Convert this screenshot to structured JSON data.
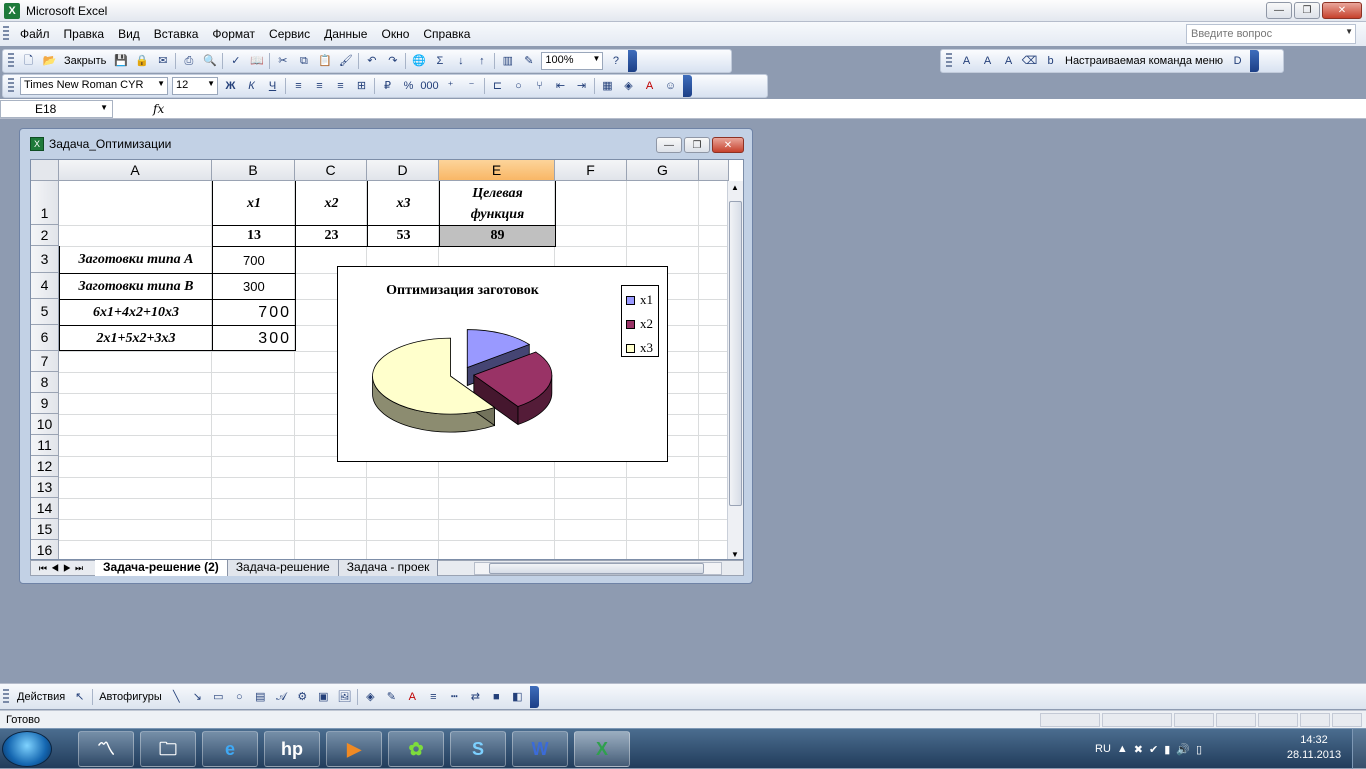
{
  "app": {
    "title": "Microsoft Excel"
  },
  "menu": [
    "Файл",
    "Правка",
    "Вид",
    "Вставка",
    "Формат",
    "Сервис",
    "Данные",
    "Окно",
    "Справка"
  ],
  "help_placeholder": "Введите вопрос",
  "toolbar": {
    "close_label": "Закрыть",
    "sigma": "Σ",
    "zoom": "100%"
  },
  "toolbar_custom": {
    "label": "Настраиваемая команда меню"
  },
  "format_toolbar": {
    "font": "Times New Roman CYR",
    "size": "12",
    "bold": "Ж",
    "italic": "К",
    "underline": "Ч",
    "percent": "%",
    "thousands": "000"
  },
  "formula_bar": {
    "name_box": "E18",
    "fx": "fx",
    "content": ""
  },
  "workbook": {
    "title": "Задача_Оптимизации"
  },
  "columns": [
    "A",
    "B",
    "C",
    "D",
    "E",
    "F",
    "G"
  ],
  "rows": [
    "1",
    "2",
    "3",
    "4",
    "5",
    "6",
    "7",
    "8",
    "9",
    "10",
    "11",
    "12",
    "13",
    "14",
    "15",
    "16"
  ],
  "cells": {
    "B1": "x1",
    "C1": "x2",
    "D1": "x3",
    "E1_line1": "Целевая",
    "E1_line2": "функция",
    "B2": "13",
    "C2": "23",
    "D2": "53",
    "E2": "89",
    "A3": "Заготовки типа А",
    "B3": "700",
    "A4": "Заготовки типа В",
    "B4": "300",
    "A5": "6x1+4x2+10x3",
    "B5": "700",
    "A6": "2x1+5x2+3x3",
    "B6": "300"
  },
  "chart_data": {
    "type": "pie",
    "title": "Оптимизация заготовок",
    "categories": [
      "x1",
      "x2",
      "x3"
    ],
    "values": [
      13,
      23,
      53
    ],
    "colors": [
      "#9999ff",
      "#993366",
      "#ffffcc"
    ],
    "style": "3d-exploded",
    "legend": "right"
  },
  "sheet_tabs": [
    "Задача-решение (2)",
    "Задача-решение",
    "Задача - проек"
  ],
  "draw_toolbar": {
    "actions": "Действия",
    "autoshapes": "Автофигуры"
  },
  "status": {
    "text": "Готово"
  },
  "taskbar": {
    "lang": "RU",
    "time": "14:32",
    "date": "28.11.2013"
  }
}
